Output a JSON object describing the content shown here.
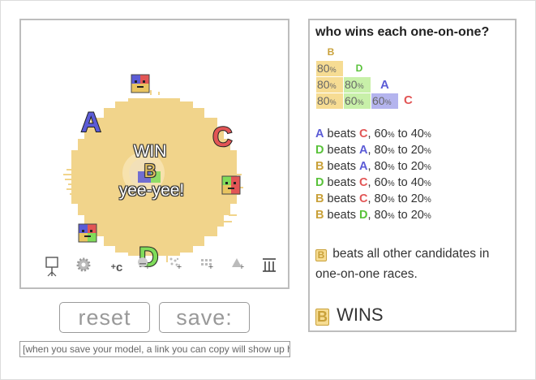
{
  "colors": {
    "A": "#5b5bd6",
    "B": "#e8c460",
    "C": "#e25555",
    "D": "#7fdc5a",
    "blob": "#f1d48b"
  },
  "sim": {
    "candidates": [
      {
        "id": "A",
        "label": "A",
        "color": "#5b5bd6"
      },
      {
        "id": "C",
        "label": "C",
        "color": "#e25555"
      },
      {
        "id": "D",
        "label": "D",
        "color": "#7fdc5a"
      }
    ],
    "overlay": {
      "line1": "WIN",
      "winner": "B",
      "line2": "yee-yee!"
    },
    "tools": [
      {
        "name": "add-voter-tool-icon",
        "glyph": "⚲"
      },
      {
        "name": "settings-gear-icon",
        "glyph": "⚙"
      },
      {
        "name": "add-candidate-icon",
        "glyph": "+c"
      },
      {
        "name": "add-voter-face-icon",
        "glyph": "+☺"
      },
      {
        "name": "add-dots-icon",
        "glyph": "+⁘"
      },
      {
        "name": "add-grid-icon",
        "glyph": "+⁙"
      },
      {
        "name": "add-triangle-icon",
        "glyph": "+▲"
      },
      {
        "name": "columns-icon",
        "glyph": "Ⅲ"
      }
    ]
  },
  "buttons": {
    "reset": "reset",
    "save": "save:"
  },
  "save_link": {
    "placeholder": "[when you save your model, a link you can copy will show up here]"
  },
  "panel": {
    "title": "who wins each one-on-one?",
    "matrix": {
      "headers": [
        "B",
        "D",
        "A",
        "C"
      ],
      "rows": [
        [
          "80",
          "%"
        ],
        [
          "80",
          "%",
          "80",
          "%"
        ],
        [
          "80",
          "%",
          "60",
          "%",
          "60",
          "%"
        ]
      ]
    },
    "results": [
      {
        "w": "A",
        "text": " beats ",
        "l": "C",
        "score": ", 60",
        "s2": " to 40"
      },
      {
        "w": "D",
        "text": " beats ",
        "l": "A",
        "score": ", 80",
        "s2": " to 20"
      },
      {
        "w": "B",
        "text": " beats ",
        "l": "A",
        "score": ", 80",
        "s2": " to 20"
      },
      {
        "w": "D",
        "text": " beats ",
        "l": "C",
        "score": ", 60",
        "s2": " to 40"
      },
      {
        "w": "B",
        "text": " beats ",
        "l": "C",
        "score": ", 80",
        "s2": " to 20"
      },
      {
        "w": "B",
        "text": " beats ",
        "l": "D",
        "score": ", 80",
        "s2": " to 20"
      }
    ],
    "summary": {
      "winner": "B",
      "text": " beats all other candidates in one-on-one races."
    },
    "final": {
      "winner": "B",
      "text": " WINS"
    }
  }
}
